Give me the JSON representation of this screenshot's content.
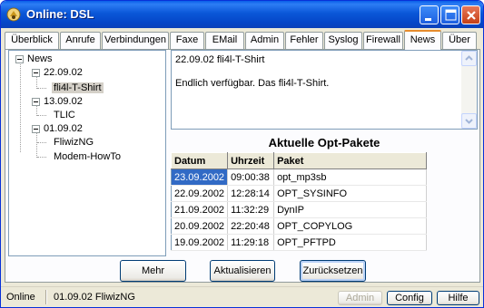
{
  "window": {
    "title": "Online: DSL"
  },
  "tabs": [
    {
      "label": "Überblick"
    },
    {
      "label": "Anrufe"
    },
    {
      "label": "Verbindungen"
    },
    {
      "label": "Faxe"
    },
    {
      "label": "EMail"
    },
    {
      "label": "Admin"
    },
    {
      "label": "Fehler"
    },
    {
      "label": "Syslog"
    },
    {
      "label": "Firewall"
    },
    {
      "label": "News",
      "active": true
    },
    {
      "label": "Über"
    }
  ],
  "tree": {
    "root": "News",
    "groups": [
      {
        "date": "22.09.02",
        "items": [
          "fli4l-T-Shirt"
        ]
      },
      {
        "date": "13.09.02",
        "items": [
          "TLIC"
        ]
      },
      {
        "date": "01.09.02",
        "items": [
          "FliwizNG",
          "Modem-HowTo"
        ]
      }
    ],
    "selected": "fli4l-T-Shirt"
  },
  "news": {
    "heading": "22.09.02 fli4l-T-Shirt",
    "body": "Endlich verfügbar. Das fli4l-T-Shirt."
  },
  "opt": {
    "title": "Aktuelle Opt-Pakete",
    "columns": [
      "Datum",
      "Uhrzeit",
      "Paket"
    ],
    "rows": [
      [
        "23.09.2002",
        "09:00:38",
        "opt_mp3sb"
      ],
      [
        "22.09.2002",
        "12:28:14",
        "OPT_SYSINFO"
      ],
      [
        "21.09.2002",
        "11:32:29",
        "DynIP"
      ],
      [
        "20.09.2002",
        "22:20:48",
        "OPT_COPYLOG"
      ],
      [
        "19.09.2002",
        "11:29:18",
        "OPT_PFTPD"
      ]
    ]
  },
  "buttons": {
    "more": "Mehr",
    "refresh": "Aktualisieren",
    "reset": "Zurücksetzen"
  },
  "status": {
    "state": "Online",
    "info": "01.09.02 FliwizNG",
    "admin": "Admin",
    "config": "Config",
    "help": "Hilfe"
  },
  "colors": {
    "titlebar": "#0a57d8",
    "selection": "#316ac5",
    "active_tab_accent": "#e68b2c"
  }
}
